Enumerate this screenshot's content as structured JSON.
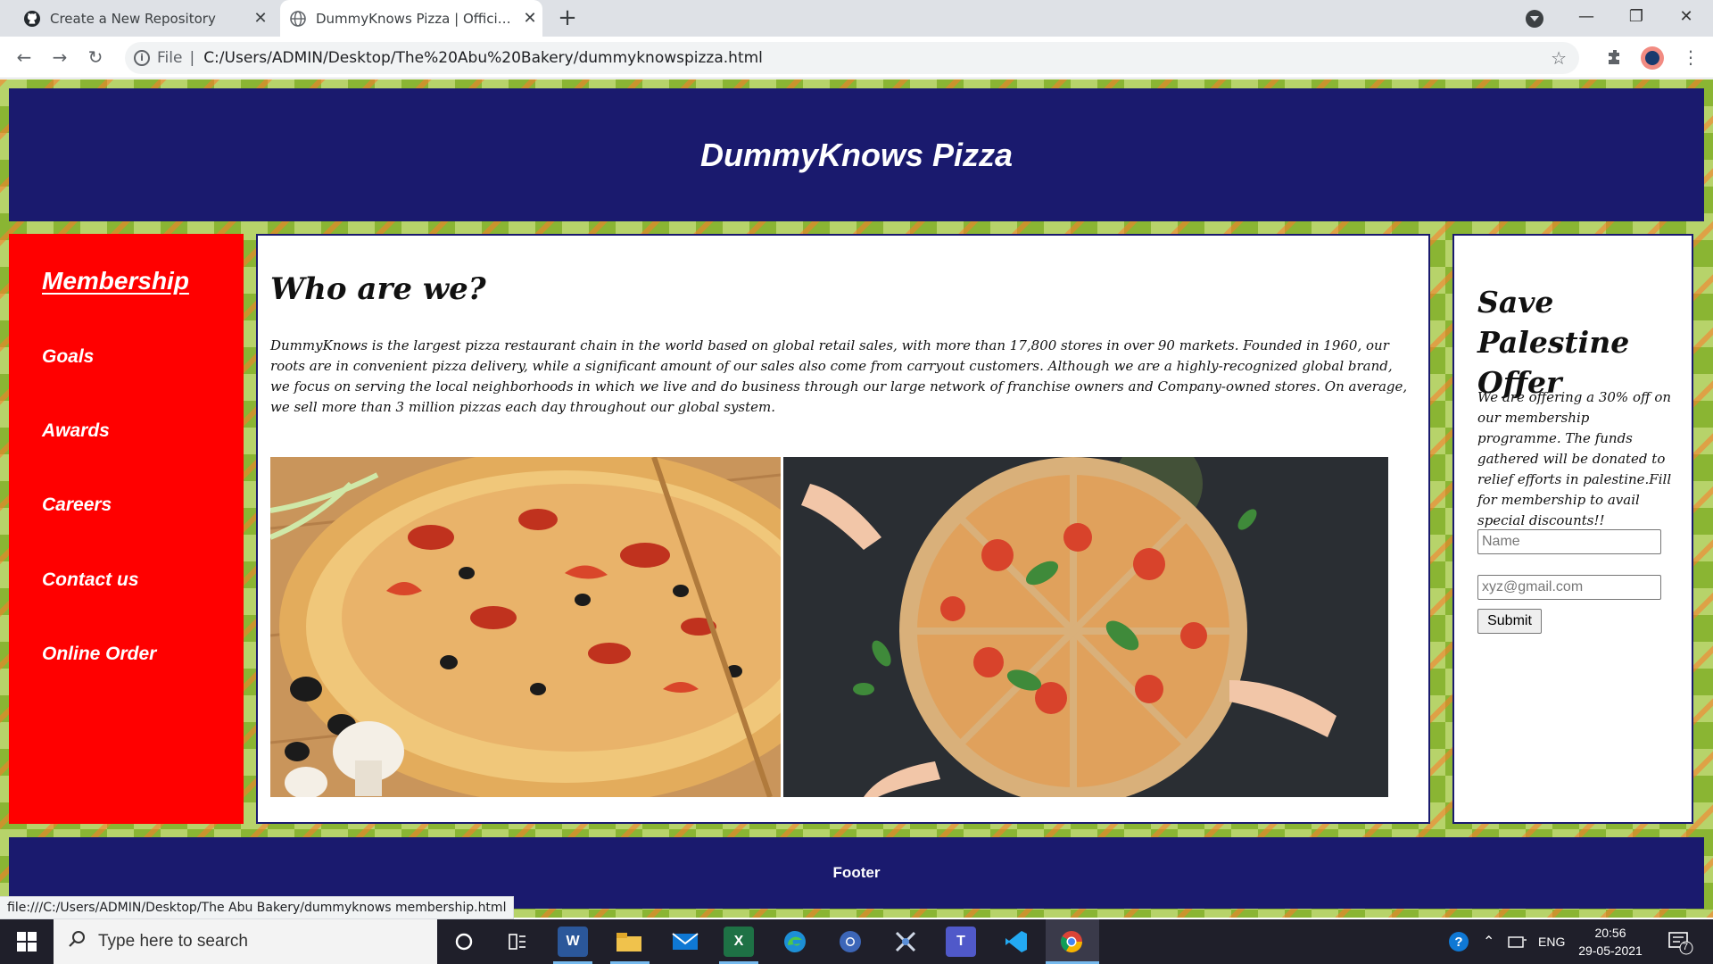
{
  "browser": {
    "tabs": [
      {
        "title": "Create a New Repository",
        "favicon": "github-icon",
        "active": false
      },
      {
        "title": "DummyKnows Pizza | Official Website",
        "favicon": "globe-icon",
        "active": true
      }
    ],
    "address": {
      "scheme": "File",
      "url": "C:/Users/ADMIN/Desktop/The%20Abu%20Bakery/dummyknowspizza.html"
    },
    "status_url": "file:///C:/Users/ADMIN/Desktop/The Abu Bakery/dummyknows membership.html"
  },
  "site": {
    "header_title": "DummyKnows Pizza",
    "nav": [
      {
        "label": "Membership"
      },
      {
        "label": "Goals"
      },
      {
        "label": "Awards"
      },
      {
        "label": "Careers"
      },
      {
        "label": "Contact us"
      },
      {
        "label": "Online Order"
      }
    ],
    "main": {
      "heading": "Who are we?",
      "body": "DummyKnows is the largest pizza restaurant chain in the world based on global retail sales, with more than 17,800 stores in over 90 markets. Founded in 1960, our roots are in convenient pizza delivery, while a significant amount of our sales also come from carryout customers. Although we are a highly-recognized global brand, we focus on serving the local neighborhoods in which we live and do business through our large network of franchise owners and Company-owned stores. On average, we sell more than 3 million pizzas each day throughout our global system."
    },
    "promo": {
      "heading": "Save Palestine Offer",
      "body": "We are offering a 30% off on our membership programme. The funds gathered will be donated to relief efforts in palestine.Fill for membership to avail special discounts!!",
      "name_placeholder": "Name",
      "email_placeholder": "xyz@gmail.com",
      "submit_label": "Submit"
    },
    "footer": "Footer",
    "colors": {
      "header": "#1a1a6e",
      "nav": "#ff0000",
      "background": "#b7d36a"
    }
  },
  "taskbar": {
    "search_placeholder": "Type here to search",
    "apps": [
      "cortana-icon",
      "task-view-icon",
      "word-icon",
      "file-explorer-icon",
      "mail-icon",
      "excel-icon",
      "edge-icon",
      "chrome-canary-icon",
      "snipping-icon",
      "teams-icon",
      "vscode-icon",
      "chrome-icon"
    ],
    "language": "ENG",
    "time": "20:56",
    "date": "29-05-2021",
    "notifications": "7"
  }
}
